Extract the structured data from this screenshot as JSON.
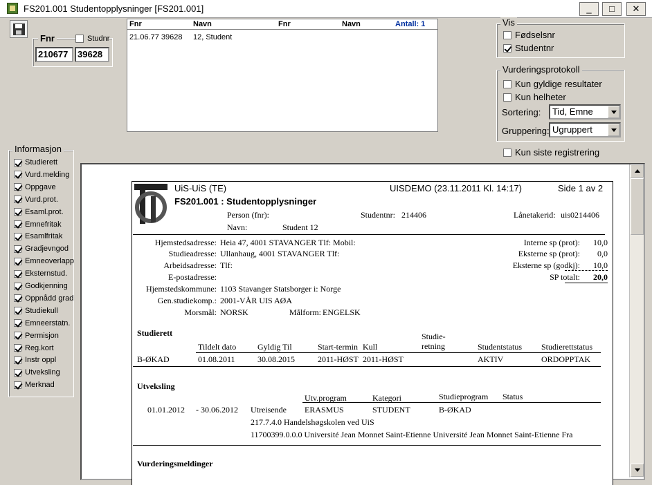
{
  "window": {
    "title": "FS201.001 Studentopplysninger  [FS201.001]",
    "buttons": {
      "minimize": "_",
      "maximize": "□",
      "close": "✕"
    }
  },
  "search": {
    "fnr_legend": "Fnr",
    "studnr_legend": "Studnr",
    "fnr_value": "210677",
    "studnr_value": "39628"
  },
  "results": {
    "headers": [
      "Fnr",
      "Navn",
      "Fnr",
      "Navn"
    ],
    "antall": "Antall: 1",
    "rows": [
      {
        "fnr": "21.06.77 39628",
        "navn": "12, Student"
      }
    ]
  },
  "vis": {
    "legend": "Vis",
    "fodselsnr": "Fødselsnr",
    "studentnr": "Studentnr"
  },
  "protokoll": {
    "legend": "Vurderingsprotokoll",
    "kun_gyldige": "Kun gyldige resultater",
    "kun_helheter": "Kun helheter",
    "sortering_label": "Sortering:",
    "sortering_value": "Tid, Emne",
    "gruppering_label": "Gruppering:",
    "gruppering_value": "Ugruppert"
  },
  "kun_siste": "Kun siste registrering",
  "informasjon": {
    "legend": "Informasjon",
    "items": [
      "Studierett",
      "Vurd.melding",
      "Oppgave",
      "Vurd.prot.",
      "Esaml.prot.",
      "Emnefritak",
      "Esamlfritak",
      "Gradjevngod",
      "Emneoverlapp",
      "Eksternstud.",
      "Godkjenning",
      "Oppnådd grad",
      "Studiekull",
      "Emneerstatn.",
      "Permisjon",
      "Reg.kort",
      "Instr oppl",
      "Utveksling",
      "Merknad"
    ]
  },
  "report": {
    "org": "UiS-UiS  (TE)",
    "system": "UISDEMO  (23.11.2011 Kl. 14:17)",
    "page": "Side 1 av 2",
    "title": "FS201.001 :  Studentopplysninger",
    "person_label": "Person (fnr):",
    "studentnr_label": "Studentnr:",
    "studentnr_value": "214406",
    "lanetaker_label": "Lånetakerid:",
    "lanetaker_value": "uis0214406",
    "navn_label": "Navn:",
    "navn_value": "Student 12",
    "hjemsted_label": "Hjemstedsadresse:",
    "hjemsted_value": "Heia 47, 4001 STAVANGER Tlf:  Mobil:",
    "studieadr_label": "Studieadresse:",
    "studieadr_value": "Ullanhaug, 4001 STAVANGER Tlf:",
    "arbeid_label": "Arbeidsadresse:",
    "arbeid_value": "Tlf:",
    "epost_label": "E-postadresse:",
    "kommune_label": "Hjemstedskommune:",
    "kommune_value": "1103 Stavanger Statsborger i: Norge",
    "genstudie_label": "Gen.studiekomp.:",
    "genstudie_value": "2001-VÅR UIS AØA",
    "morsmal_label": "Morsmål:",
    "morsmal_value": "NORSK",
    "malform_label": "Målform:",
    "malform_value": "ENGELSK",
    "sp": [
      {
        "label": "Interne sp (prot):",
        "value": "10,0"
      },
      {
        "label": "Eksterne sp (prot):",
        "value": "0,0"
      },
      {
        "label": "Eksterne sp (godkj):",
        "value": "10,0"
      },
      {
        "label": "SP totalt:",
        "value": "20,0"
      }
    ],
    "studierett": {
      "heading": "Studierett",
      "col_tildelt": "Tildelt dato",
      "col_gyldig": "Gyldig Til",
      "col_start": "Start-termin",
      "col_kull": "Kull",
      "col_retning1": "Studie-",
      "col_retning2": "retning",
      "col_status": "Studentstatus",
      "col_rettstatus": "Studierettstatus",
      "row_program": "B-ØKAD",
      "row_tildelt": "01.08.2011",
      "row_gyldig": "30.08.2015",
      "row_start": "2011-HØST",
      "row_kull": "2011-HØST",
      "row_status": "AKTIV",
      "row_rettstatus": "ORDOPPTAK"
    },
    "utveksling": {
      "heading": "Utveksling",
      "col_program": "Utv.program",
      "col_kategori": "Kategori",
      "col_studieprogram": "Studieprogram",
      "col_status": "Status",
      "from": "01.01.2012",
      "to": "- 30.06.2012",
      "type": "Utreisende",
      "program": "ERASMUS",
      "kategori": "STUDENT",
      "studieprogram": "B-ØKAD",
      "inst1": "217.7.4.0 Handelshøgskolen ved UiS",
      "inst2": "11700399.0.0.0 Université Jean Monnet Saint-Etienne Université Jean Monnet Saint-Etienne Fra"
    },
    "vurdering_heading": "Vurderingsmeldinger"
  }
}
